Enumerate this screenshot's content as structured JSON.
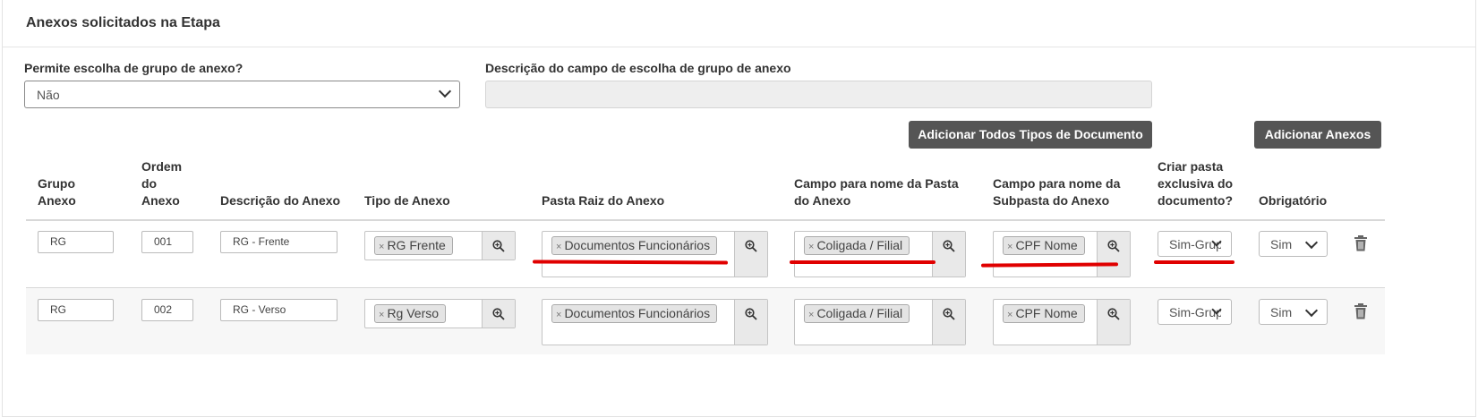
{
  "panel": {
    "title": "Anexos solicitados na Etapa"
  },
  "form": {
    "permite_label": "Permite escolha de grupo de anexo?",
    "permite_value": "Não",
    "descricao_label": "Descrição do campo de escolha de grupo de anexo",
    "descricao_value": ""
  },
  "buttons": {
    "add_all": "Adicionar Todos Tipos de Documento",
    "add_anexos": "Adicionar Anexos"
  },
  "table": {
    "headers": {
      "grupo": [
        "Grupo",
        "Anexo"
      ],
      "ordem": [
        "Ordem",
        "do",
        "Anexo"
      ],
      "descricao": [
        "Descrição do Anexo"
      ],
      "tipo": [
        "Tipo de Anexo"
      ],
      "pasta": [
        "Pasta Raiz do Anexo"
      ],
      "campo_pasta": [
        "Campo para nome da Pasta",
        "do Anexo"
      ],
      "campo_subpasta": [
        "Campo para nome da",
        "Subpasta do Anexo"
      ],
      "criar": [
        "Criar pasta",
        "exclusiva do",
        "documento?"
      ],
      "obrigatorio": [
        "Obrigatório"
      ]
    },
    "rows": [
      {
        "grupo": "RG",
        "ordem": "001",
        "descricao": "RG - Frente",
        "tipo": "RG Frente",
        "pasta": "Documentos Funcionários",
        "campo_pasta": "Coligada / Filial",
        "campo_subpasta": "CPF Nome",
        "criar": "Sim-Grupo",
        "obrigatorio": "Sim"
      },
      {
        "grupo": "RG",
        "ordem": "002",
        "descricao": "RG - Verso",
        "tipo": "Rg Verso",
        "pasta": "Documentos Funcionários",
        "campo_pasta": "Coligada / Filial",
        "campo_subpasta": "CPF Nome",
        "criar": "Sim-Grupo",
        "obrigatorio": "Sim"
      }
    ]
  },
  "icons": {
    "remove": "×",
    "lookup": "zoom-in-icon",
    "delete": "trash-icon",
    "dropdown": "chevron-down-icon"
  },
  "colors": {
    "annotation": "#e00000",
    "button": "#555555"
  }
}
